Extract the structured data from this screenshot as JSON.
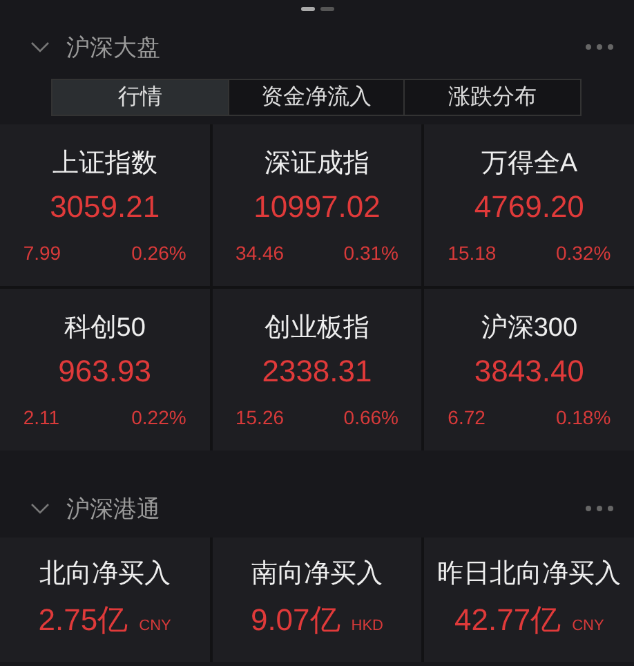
{
  "pager": [
    {
      "selected": true
    },
    {
      "selected": false
    }
  ],
  "market_section": {
    "title": "沪深大盘",
    "expanded": true,
    "tabs": [
      {
        "label": "行情",
        "selected": true
      },
      {
        "label": "资金净流入",
        "selected": false
      },
      {
        "label": "涨跌分布",
        "selected": false
      }
    ],
    "indices": [
      {
        "name": "上证指数",
        "value": "3059.21",
        "change": "7.99",
        "percent": "0.26%"
      },
      {
        "name": "深证成指",
        "value": "10997.02",
        "change": "34.46",
        "percent": "0.31%"
      },
      {
        "name": "万得全A",
        "value": "4769.20",
        "change": "15.18",
        "percent": "0.32%"
      },
      {
        "name": "科创50",
        "value": "963.93",
        "change": "2.11",
        "percent": "0.22%"
      },
      {
        "name": "创业板指",
        "value": "2338.31",
        "change": "15.26",
        "percent": "0.66%"
      },
      {
        "name": "沪深300",
        "value": "3843.40",
        "change": "6.72",
        "percent": "0.18%"
      }
    ]
  },
  "connect_section": {
    "title": "沪深港通",
    "expanded": true,
    "flows": [
      {
        "name": "北向净买入",
        "value": "2.75亿",
        "currency": "CNY"
      },
      {
        "name": "南向净买入",
        "value": "9.07亿",
        "currency": "HKD"
      },
      {
        "name": "昨日北向净买入",
        "value": "42.77亿",
        "currency": "CNY"
      }
    ]
  }
}
